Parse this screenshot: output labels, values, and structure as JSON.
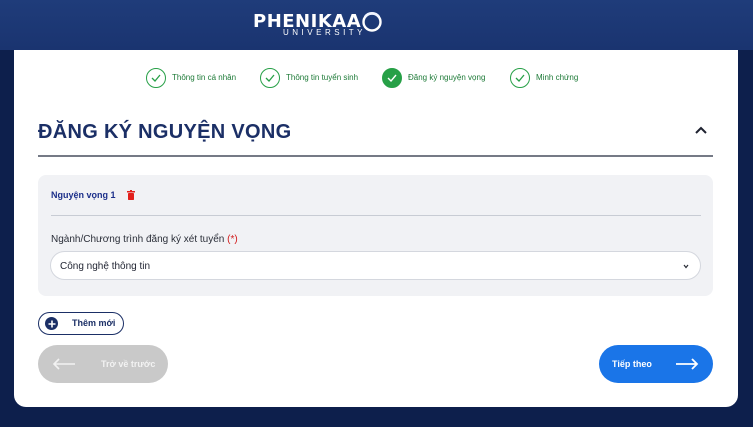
{
  "header": {
    "brand": "PHENIKAA",
    "brand_sub": "UNIVERSITY"
  },
  "steps": [
    {
      "label": "Thông tin cá nhân",
      "state": "done"
    },
    {
      "label": "Thông tin tuyển sinh",
      "state": "done"
    },
    {
      "label": "Đăng ký nguyện vọng",
      "state": "active"
    },
    {
      "label": "Minh chứng",
      "state": "done"
    }
  ],
  "section": {
    "title": "ĐĂNG KÝ NGUYỆN VỌNG",
    "collapse_icon": "chevron-up-icon"
  },
  "wish": {
    "title": "Nguyện vọng 1",
    "delete_icon": "trash-icon",
    "field_label": "Ngành/Chương trình đăng ký xét tuyển",
    "required_mark": "(*)",
    "selected_value": "Công nghệ thông tin"
  },
  "actions": {
    "add_label": "Thêm mới",
    "back_label": "Trở về trước",
    "next_label": "Tiếp theo"
  },
  "colors": {
    "navy": "#1b2f66",
    "green": "#27a047",
    "blue": "#1a75e8",
    "disabled": "#c9c9c9",
    "required": "#d11a1a"
  }
}
